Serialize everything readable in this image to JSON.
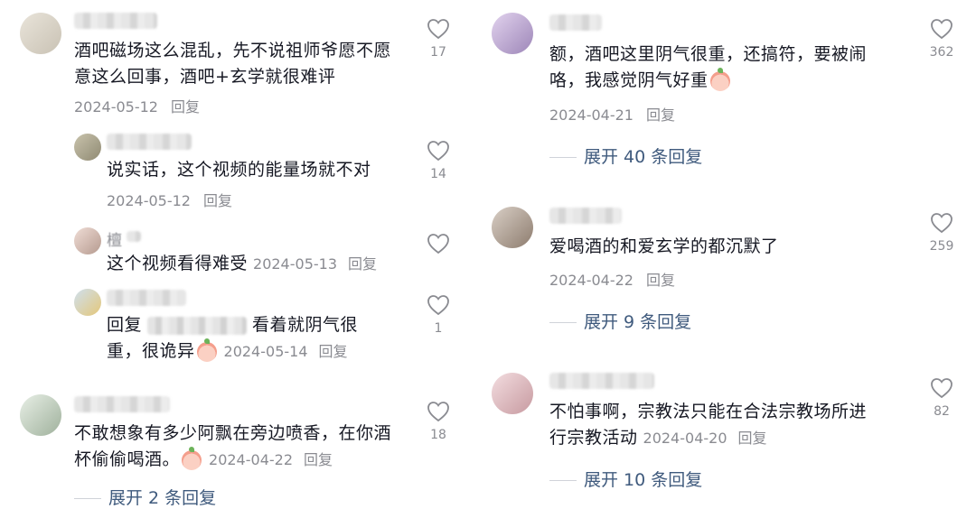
{
  "left": {
    "comments": [
      {
        "text": "酒吧磁场这么混乱，先不说祖师爷愿不愿意这么回事，酒吧+玄学就很难评",
        "date": "2024-05-12",
        "reply": "回复",
        "likes": "17"
      }
    ],
    "replies": [
      {
        "text": "说实话，这个视频的能量场就不对",
        "date": "2024-05-12",
        "reply": "回复",
        "likes": "14"
      },
      {
        "name_char": "檀",
        "text": "这个视频看得难受",
        "date": "2024-05-13",
        "reply": "回复",
        "likes": ""
      },
      {
        "prefix": "回复",
        "text_a": "看着就阴气很",
        "text_b": "重，很诡异",
        "date": "2024-05-14",
        "reply": "回复",
        "likes": "1"
      }
    ],
    "comment2": {
      "text_a": "不敢想象有多少阿飘在旁边喷香，在你酒",
      "text_b": "杯偷偷喝酒。",
      "date": "2024-04-22",
      "reply": "回复",
      "likes": "18",
      "expand": "展开 2 条回复"
    }
  },
  "right": {
    "comment1": {
      "text_a": "额，酒吧这里阴气很重，还搞符，要被闹",
      "text_b": "咯，我感觉阴气好重",
      "date": "2024-04-21",
      "reply": "回复",
      "likes": "362",
      "expand": "展开 40 条回复"
    },
    "comment2": {
      "text": "爱喝酒的和爱玄学的都沉默了",
      "date": "2024-04-22",
      "reply": "回复",
      "likes": "259",
      "expand": "展开 9 条回复"
    },
    "comment3": {
      "text_a": "不怕事啊，宗教法只能在合法宗教场所进",
      "text_b": "行宗教活动",
      "date": "2024-04-20",
      "reply": "回复",
      "likes": "82",
      "expand": "展开 10 条回复"
    }
  },
  "icons": {
    "like": "heart-outline-icon",
    "emoji": "peach-face-emoji"
  },
  "colors": {
    "text": "#161823",
    "meta": "#8a8b91",
    "expand": "#3f5a7d"
  }
}
